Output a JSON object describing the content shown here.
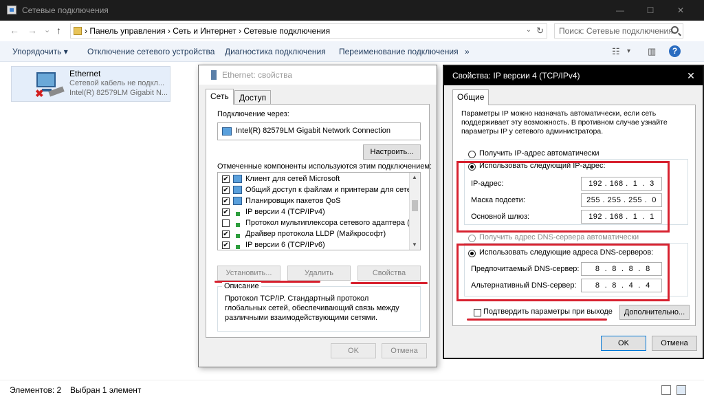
{
  "window": {
    "title": "Сетевые подключения",
    "min": "—",
    "max": "☐",
    "close": "✕"
  },
  "nav": {
    "back": "←",
    "forward": "→",
    "history": "⌄",
    "up": "↑",
    "breadcrumb": "›  Панель управления  ›  Сеть и Интернет  ›  Сетевые подключения",
    "dropdown": "⌄",
    "refresh": "↻",
    "search_placeholder": "Поиск: Сетевые подключения"
  },
  "commands": {
    "organize": "Упорядочить ▾",
    "disable": "Отключение сетевого устройства",
    "diagnose": "Диагностика подключения",
    "rename": "Переименование подключения",
    "more": "»",
    "view_dd": "▾",
    "help": "?"
  },
  "adapter": {
    "name": "Ethernet",
    "status": "Сетевой кабель не подкл...",
    "device": "Intel(R) 82579LM Gigabit N..."
  },
  "status": {
    "count": "Элементов: 2",
    "selected": "Выбран 1 элемент"
  },
  "eth_dialog": {
    "title": "Ethernet: свойства",
    "tab_network": "Сеть",
    "tab_sharing": "Доступ",
    "connect_using": "Подключение через:",
    "adapter_name": "Intel(R) 82579LM Gigabit Network Connection",
    "configure": "Настроить...",
    "components_label": "Отмеченные компоненты используются этим подключением:",
    "components": [
      {
        "label": "Клиент для сетей Microsoft",
        "checked": "✔",
        "icon": "blue"
      },
      {
        "label": "Общий доступ к файлам и принтерам для сетей Mi",
        "checked": "✔",
        "icon": "blue"
      },
      {
        "label": "Планировщик пакетов QoS",
        "checked": "✔",
        "icon": "blue"
      },
      {
        "label": "IP версии 4 (TCP/IPv4)",
        "checked": "✔",
        "icon": "green"
      },
      {
        "label": "Протокол мультиплексора сетевого адаптера (Mai",
        "checked": "",
        "icon": "green"
      },
      {
        "label": "Драйвер протокола LLDP (Майкрософт)",
        "checked": "✔",
        "icon": "green"
      },
      {
        "label": "IP версии 6 (TCP/IPv6)",
        "checked": "✔",
        "icon": "green"
      }
    ],
    "scroll_up": "▲",
    "scroll_down": "▼",
    "install": "Установить...",
    "uninstall": "Удалить",
    "properties": "Свойства",
    "description_title": "Описание",
    "description": "Протокол TCP/IP. Стандартный протокол глобальных сетей, обеспечивающий связь между различными взаимодействующими сетями.",
    "ok": "OK",
    "cancel": "Отмена"
  },
  "ipv4_dialog": {
    "title": "Свойства: IP версии 4 (TCP/IPv4)",
    "close": "✕",
    "tab_general": "Общие",
    "intro": "Параметры IP можно назначать автоматически, если сеть поддерживает эту возможность. В противном случае узнайте параметры IP у сетевого администратора.",
    "auto_ip": "Получить IP-адрес автоматически",
    "manual_ip": "Использовать следующий IP-адрес:",
    "ip_label": "IP-адрес:",
    "ip_value": "192 . 168 .  1  .  3",
    "mask_label": "Маска подсети:",
    "mask_value": "255 . 255 . 255 .  0",
    "gateway_label": "Основной шлюз:",
    "gateway_value": "192 . 168 .  1  .  1",
    "auto_dns": "Получить адрес DNS-сервера автоматически",
    "manual_dns": "Использовать следующие адреса DNS-серверов:",
    "pref_dns_label": "Предпочитаемый DNS-сервер:",
    "pref_dns_value": " 8  .  8  .  8  .  8",
    "alt_dns_label": "Альтернативный DNS-сервер:",
    "alt_dns_value": " 8  .  8  .  4  .  4",
    "validate": "Подтвердить параметры при выходе",
    "advanced": "Дополнительно...",
    "ok": "OK",
    "cancel": "Отмена"
  },
  "colors": {
    "highlight": "#d7212f",
    "titlebar": "#1c1c1c",
    "accent": "#0078d7"
  }
}
